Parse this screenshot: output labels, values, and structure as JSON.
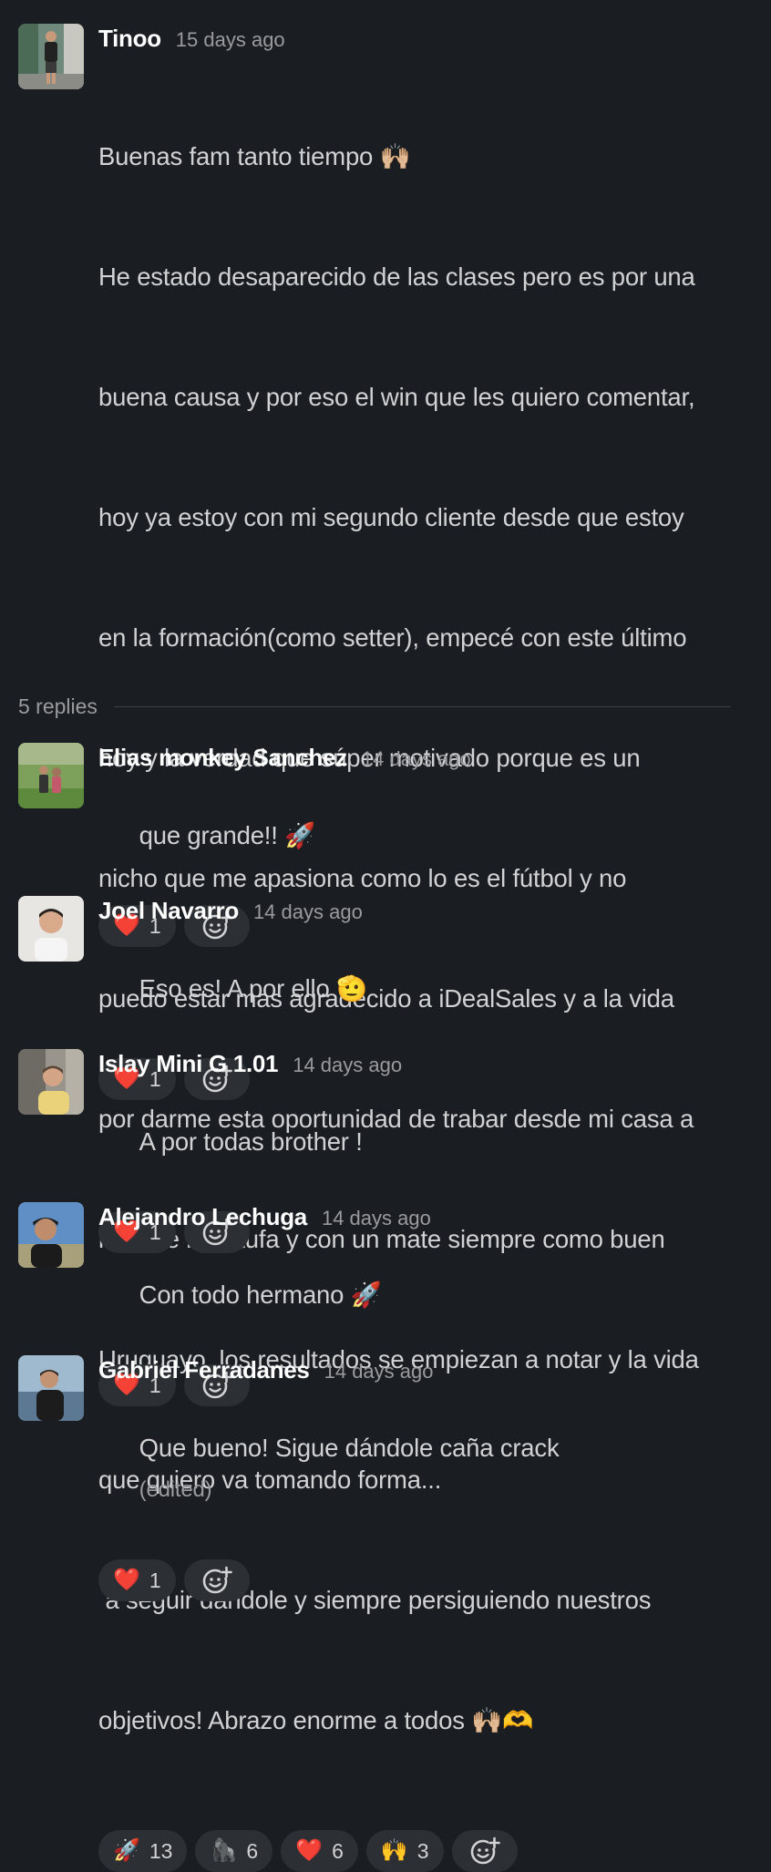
{
  "root": {
    "author": "Tinoo",
    "time": "15 days ago",
    "lines": [
      "Buenas fam tanto tiempo 🙌🏼",
      "He estado desaparecido de las clases pero es por una",
      "buena causa y por eso el win que les quiero comentar,",
      "hoy ya estoy con mi segundo cliente desde que estoy",
      "en la formación(como setter), empecé con este último",
      "hoy y la verdad que súper motivado porque es un",
      "nicho que me apasiona como lo es el fútbol y no",
      "puedo estar mas agradecido a iDealSales y a la vida",
      "por darme esta oportunidad de trabar desde mi casa a",
      "lado de la estufa y con un mate siempre como buen",
      "Uruguayo, los resultados se empiezan a notar y la vida",
      "que quiero va tomando forma...",
      " a seguir dandole y siempre persiguiendo nuestros",
      "objetivos! Abrazo enorme a todos 🙌🏼🫶"
    ],
    "reactions": [
      {
        "emoji": "🚀",
        "count": "13"
      },
      {
        "emoji": "🦍",
        "count": "6"
      },
      {
        "emoji": "❤️",
        "count": "6"
      },
      {
        "emoji": "🙌",
        "count": "3"
      }
    ]
  },
  "replies_label": "5 replies",
  "replies": [
    {
      "author": "Elias monkey Sanchez",
      "time": "14 days ago",
      "text": "que grande!! 🚀",
      "edited": "",
      "reaction": {
        "emoji": "❤️",
        "count": "1"
      }
    },
    {
      "author": "Joel Navarro",
      "time": "14 days ago",
      "text": "Eso es! A por ello 🫡",
      "edited": "",
      "reaction": {
        "emoji": "❤️",
        "count": "1"
      }
    },
    {
      "author": "Islay Mini G 1.01",
      "time": "14 days ago",
      "text": "A por todas brother !",
      "edited": "",
      "reaction": {
        "emoji": "❤️",
        "count": "1"
      }
    },
    {
      "author": "Alejandro Lechuga",
      "time": "14 days ago",
      "text": "Con todo hermano 🚀",
      "edited": "",
      "reaction": {
        "emoji": "❤️",
        "count": "1"
      }
    },
    {
      "author": "Gabriel Ferradanes",
      "time": "14 days ago",
      "text": "Que bueno! Sigue dándole caña crack",
      "edited": "(edited)",
      "reaction": {
        "emoji": "❤️",
        "count": "1"
      }
    }
  ],
  "icons": {
    "add_reaction": "add-reaction-icon"
  },
  "colors": {
    "background": "#1a1d21",
    "pill": "#2c2f33",
    "name": "#ffffff",
    "text": "#d1d2d3",
    "muted": "#9a9b9e"
  }
}
